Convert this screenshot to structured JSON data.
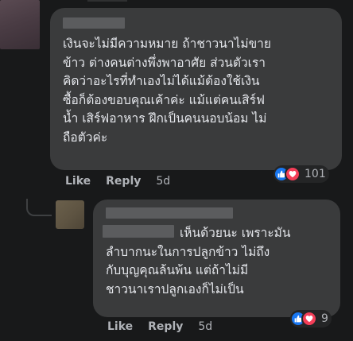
{
  "comments": [
    {
      "text_lines": [
        "เงินจะไม่มีความหมาย ถ้าชาวนาไม่ขาย",
        "ข้าว ต่างคนต่างพึ่งพาอาศัย ส่วนตัวเรา",
        "คิดว่าอะไรที่ทำเองไม่ได้แม้ต้องใช้เงิน",
        "ซื้อก็ต้องขอบคุณเค้าค่ะ แม้แต่คนเสิร์ฟ",
        "น้ำ เสิร์ฟอาหาร ฝึกเป็นคนนอบน้อม ไม่",
        "ถือตัวค่ะ"
      ],
      "reaction_count": "101",
      "actions": {
        "like": "Like",
        "reply": "Reply",
        "time": "5d"
      }
    },
    {
      "text_lines": [
        "เห็นด้วยนะ เพราะมัน",
        "ลำบากนะในการปลูกข้าว ไม่ถึง",
        "กับบุญคุณล้นพ้น แต่ถ้าไม่มี",
        "ชาวนาเราปลูกเองก็ไม่เป็น"
      ],
      "reaction_count": "9",
      "actions": {
        "like": "Like",
        "reply": "Reply",
        "time": "5d"
      }
    }
  ],
  "reaction_icons": [
    "like-icon",
    "love-icon"
  ],
  "colors": {
    "background": "#18191a",
    "bubble": "#3a3b3c",
    "text": "#e4e6eb",
    "muted": "#b0b3b8",
    "like_blue": "#1877f2",
    "love_red": "#f33e58"
  }
}
